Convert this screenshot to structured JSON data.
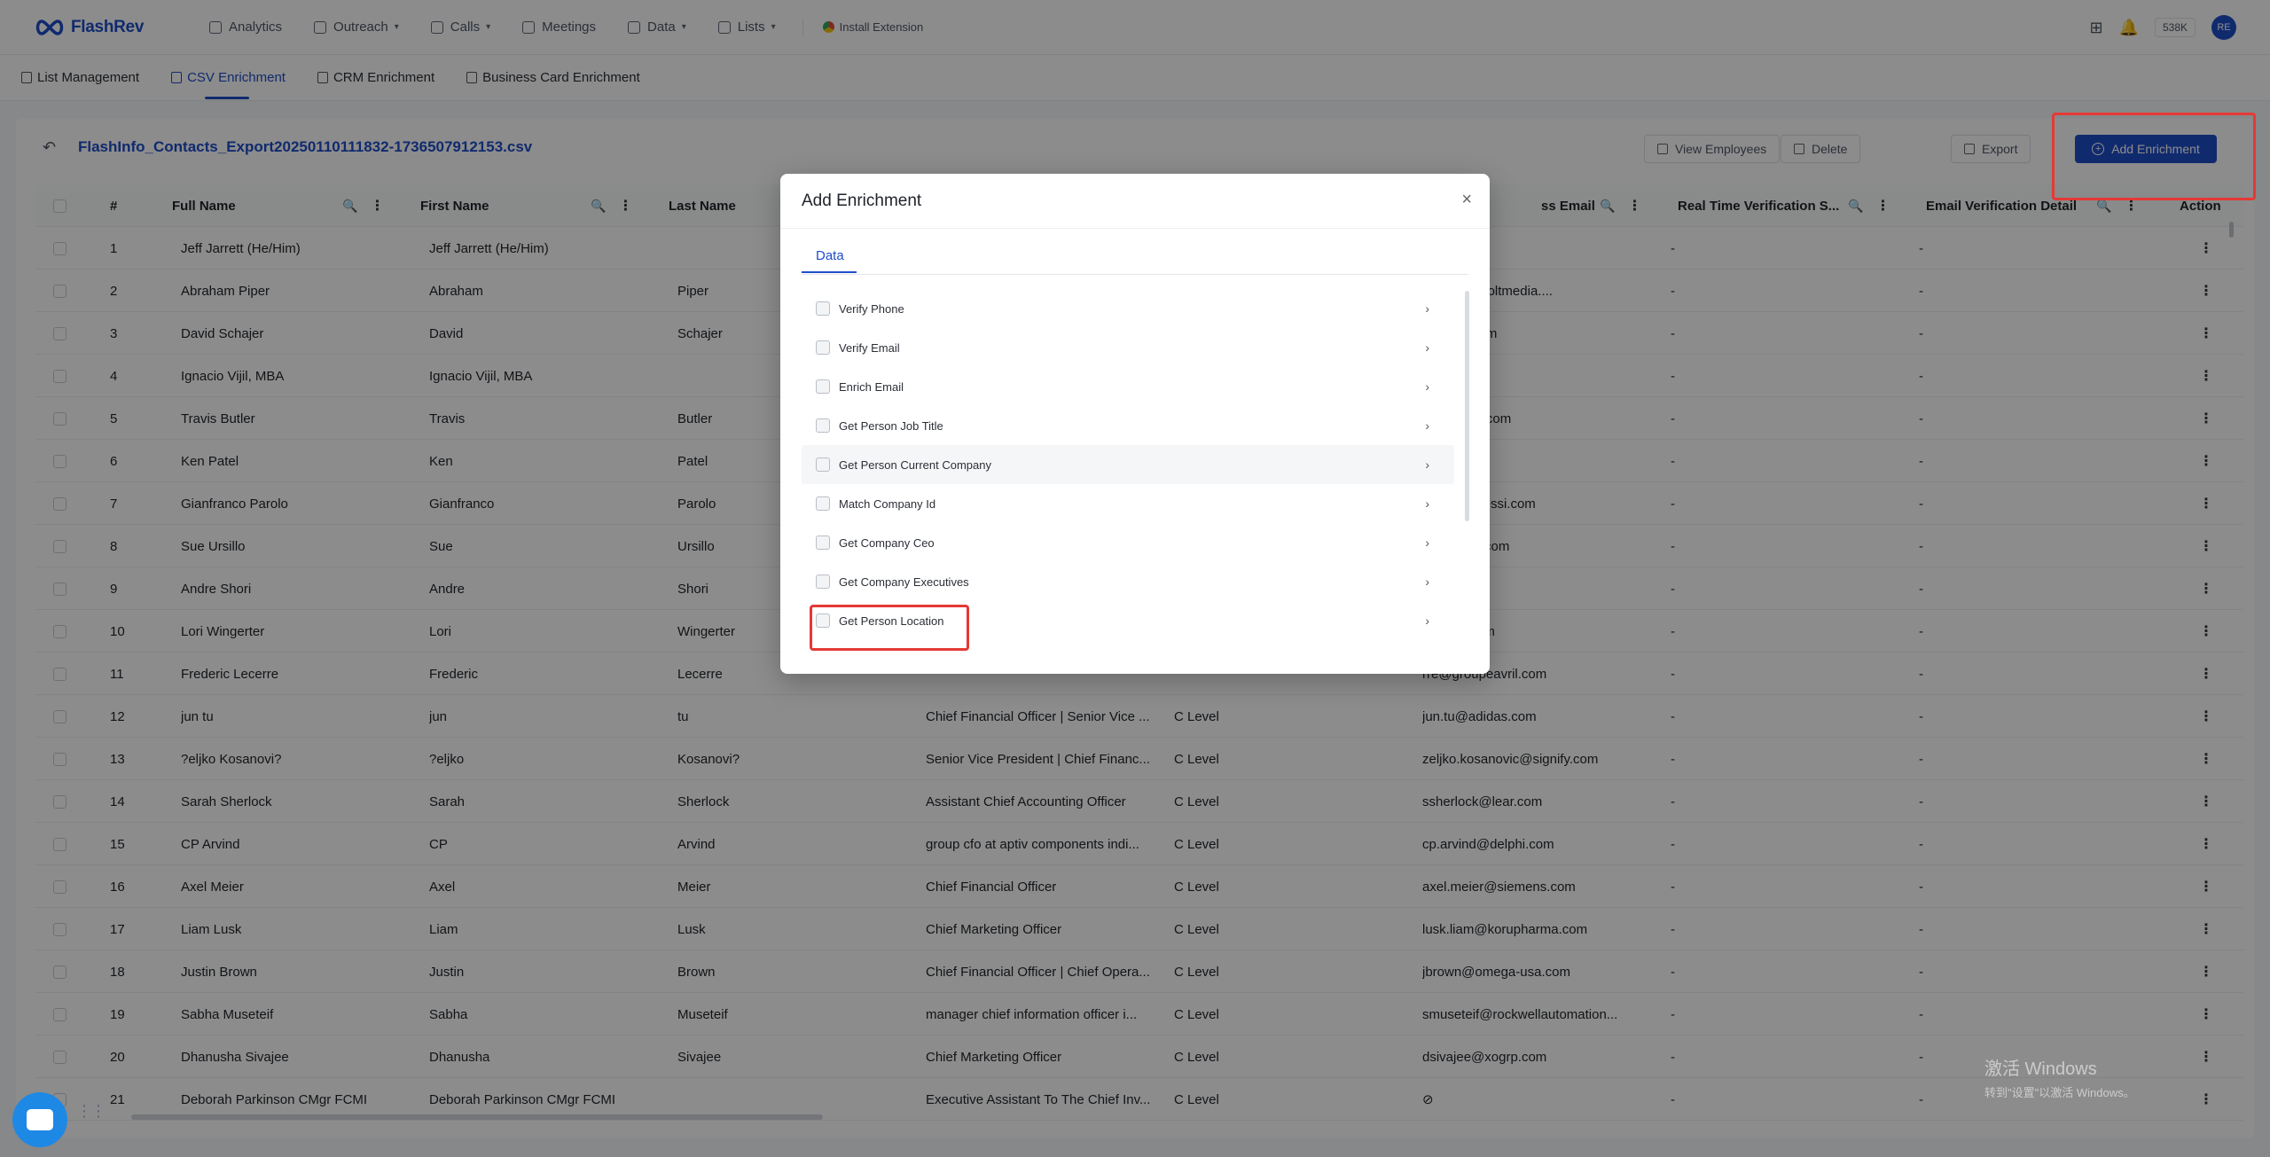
{
  "app": {
    "brand": "FlashRev"
  },
  "nav": {
    "items": [
      {
        "label": "Analytics",
        "chevron": false
      },
      {
        "label": "Outreach",
        "chevron": true
      },
      {
        "label": "Calls",
        "chevron": true
      },
      {
        "label": "Meetings",
        "chevron": false
      },
      {
        "label": "Data",
        "chevron": true
      },
      {
        "label": "Lists",
        "chevron": true
      }
    ],
    "install_extension": "Install Extension",
    "credits": "538K",
    "avatar_text": "RE"
  },
  "subtabs": [
    {
      "label": "List Management",
      "active": false
    },
    {
      "label": "CSV Enrichment",
      "active": true
    },
    {
      "label": "CRM Enrichment",
      "active": false
    },
    {
      "label": "Business Card Enrichment",
      "active": false
    }
  ],
  "file": {
    "name": "FlashInfo_Contacts_Export20250110111832-1736507912153.csv"
  },
  "toolbar": {
    "view_employees": "View Employees",
    "delete": "Delete",
    "export": "Export",
    "add_enrichment": "Add Enrichment"
  },
  "table": {
    "headers": {
      "num": "#",
      "full_name": "Full Name",
      "first_name": "First Name",
      "last_name": "Last Name",
      "business_email": "Business Email",
      "business_email_visible": "ss Email",
      "real_time": "Real Time Verification S...",
      "email_detail": "Email Verification Detail",
      "action": "Action"
    },
    "rows": [
      {
        "n": "1",
        "full": "Jeff Jarrett (He/Him)",
        "first": "Jeff Jarrett (He/Him)",
        "last": "",
        "title": "",
        "level": "",
        "email": "payer.com",
        "rt": "-",
        "ed": "-"
      },
      {
        "n": "2",
        "full": "Abraham Piper",
        "first": "Abraham",
        "last": "Piper",
        "title": "",
        "level": "",
        "email": "per@brainjoltmedia....",
        "rt": "-",
        "ed": "-"
      },
      {
        "n": "3",
        "full": "David Schajer",
        "first": "David",
        "last": "Schajer",
        "title": "",
        "level": "",
        "email": "r@hella.com",
        "rt": "-",
        "ed": "-"
      },
      {
        "n": "4",
        "full": "Ignacio Vijil, MBA",
        "first": "Ignacio Vijil, MBA",
        "last": "",
        "title": "",
        "level": "",
        "email": "",
        "rt": "-",
        "ed": "-"
      },
      {
        "n": "5",
        "full": "Travis Butler",
        "first": "Travis",
        "last": "Butler",
        "title": "",
        "level": "",
        "email": "@novartis.com",
        "rt": "-",
        "ed": "-"
      },
      {
        "n": "6",
        "full": "Ken Patel",
        "first": "Ken",
        "last": "Patel",
        "title": "",
        "level": "",
        "email": ".com",
        "rt": "-",
        "ed": "-"
      },
      {
        "n": "7",
        "full": "Gianfranco Parolo",
        "first": "Gianfranco",
        "last": "Parolo",
        "title": "",
        "level": "",
        "email": "parolo@alessi.com",
        "rt": "-",
        "ed": "-"
      },
      {
        "n": "8",
        "full": "Sue Ursillo",
        "first": "Sue",
        "last": "Ursillo",
        "title": "",
        "level": "",
        "email": "medtronic.com",
        "rt": "-",
        "ed": "-"
      },
      {
        "n": "9",
        "full": "Andre Shori",
        "first": "Andre",
        "last": "Shori",
        "title": "",
        "level": "",
        "email": "@se.com",
        "rt": "-",
        "ed": "-"
      },
      {
        "n": "10",
        "full": "Lori Wingerter",
        "first": "Lori",
        "last": "Wingerter",
        "title": "",
        "level": "",
        "email": "er@gm.com",
        "rt": "-",
        "ed": "-"
      },
      {
        "n": "11",
        "full": "Frederic Lecerre",
        "first": "Frederic",
        "last": "Lecerre",
        "title": "",
        "level": "",
        "email": "rre@groupeavril.com",
        "rt": "-",
        "ed": "-"
      },
      {
        "n": "12",
        "full": "jun tu",
        "first": "jun",
        "last": "tu",
        "title": "Chief Financial Officer | Senior Vice ...",
        "level": "C Level",
        "email": "jun.tu@adidas.com",
        "rt": "-",
        "ed": "-"
      },
      {
        "n": "13",
        "full": "?eljko Kosanovi?",
        "first": "?eljko",
        "last": "Kosanovi?",
        "title": "Senior Vice President | Chief Financ...",
        "level": "C Level",
        "email": "zeljko.kosanovic@signify.com",
        "rt": "-",
        "ed": "-"
      },
      {
        "n": "14",
        "full": "Sarah Sherlock",
        "first": "Sarah",
        "last": "Sherlock",
        "title": "Assistant Chief Accounting Officer",
        "level": "C Level",
        "email": "ssherlock@lear.com",
        "rt": "-",
        "ed": "-"
      },
      {
        "n": "15",
        "full": "CP Arvind",
        "first": "CP",
        "last": "Arvind",
        "title": "group cfo at aptiv components indi...",
        "level": "C Level",
        "email": "cp.arvind@delphi.com",
        "rt": "-",
        "ed": "-"
      },
      {
        "n": "16",
        "full": "Axel Meier",
        "first": "Axel",
        "last": "Meier",
        "title": "Chief Financial Officer",
        "level": "C Level",
        "email": "axel.meier@siemens.com",
        "rt": "-",
        "ed": "-"
      },
      {
        "n": "17",
        "full": "Liam Lusk",
        "first": "Liam",
        "last": "Lusk",
        "title": "Chief Marketing Officer",
        "level": "C Level",
        "email": "lusk.liam@korupharma.com",
        "rt": "-",
        "ed": "-"
      },
      {
        "n": "18",
        "full": "Justin Brown",
        "first": "Justin",
        "last": "Brown",
        "title": "Chief Financial Officer | Chief Opera...",
        "level": "C Level",
        "email": "jbrown@omega-usa.com",
        "rt": "-",
        "ed": "-"
      },
      {
        "n": "19",
        "full": "Sabha Museteif",
        "first": "Sabha",
        "last": "Museteif",
        "title": "manager chief information officer i...",
        "level": "C Level",
        "email": "smuseteif@rockwellautomation...",
        "rt": "-",
        "ed": "-"
      },
      {
        "n": "20",
        "full": "Dhanusha Sivajee",
        "first": "Dhanusha",
        "last": "Sivajee",
        "title": "Chief Marketing Officer",
        "level": "C Level",
        "email": "dsivajee@xogrp.com",
        "rt": "-",
        "ed": "-"
      },
      {
        "n": "21",
        "full": "Deborah Parkinson CMgr FCMI",
        "first": "Deborah Parkinson CMgr FCMI",
        "last": "",
        "title": "Executive Assistant To The Chief Inv...",
        "level": "C Level",
        "email": "⊘",
        "rt": "-",
        "ed": "-"
      }
    ]
  },
  "modal": {
    "title": "Add Enrichment",
    "tab": "Data",
    "items": [
      {
        "label": "Verify Phone"
      },
      {
        "label": "Verify Email"
      },
      {
        "label": "Enrich Email"
      },
      {
        "label": "Get Person Job Title"
      },
      {
        "label": "Get Person Current Company"
      },
      {
        "label": "Match Company Id"
      },
      {
        "label": "Get Company Ceo"
      },
      {
        "label": "Get Company Executives"
      },
      {
        "label": "Get Person Location"
      }
    ]
  },
  "watermark": {
    "line1": "激活 Windows",
    "line2": "转到\"设置\"以激活 Windows。"
  }
}
